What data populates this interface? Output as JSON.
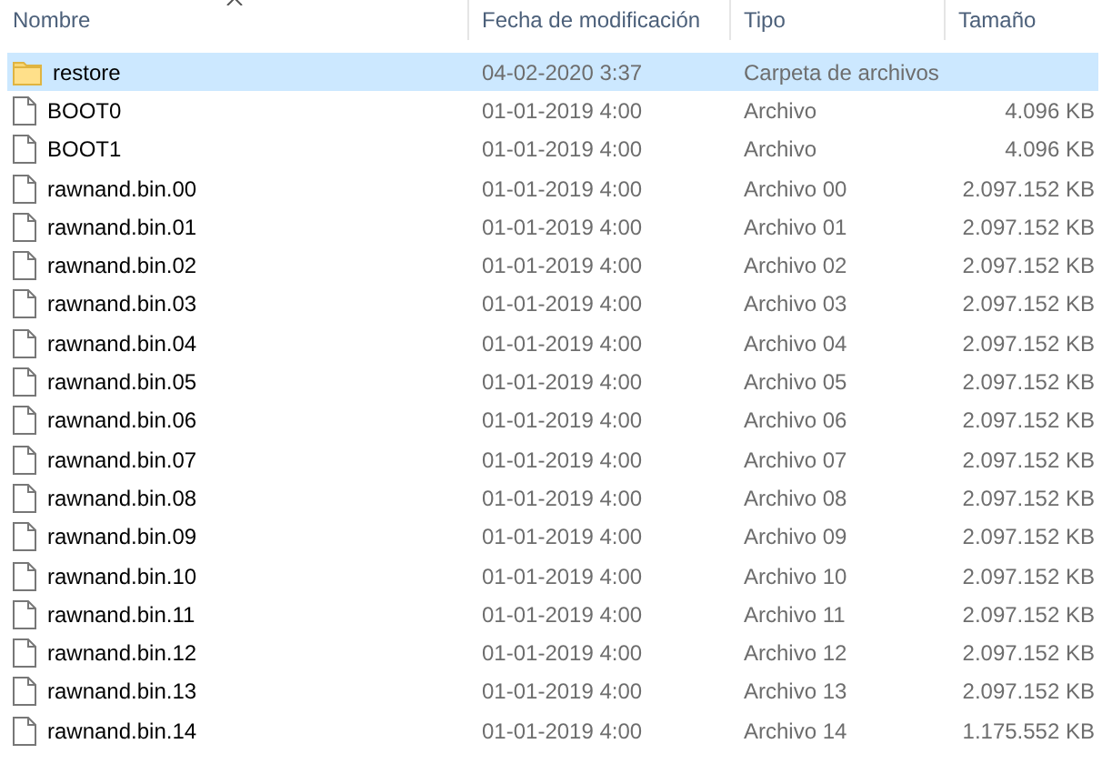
{
  "columns": [
    {
      "label": "Nombre",
      "sorted": true
    },
    {
      "label": "Fecha de modificación",
      "sorted": false
    },
    {
      "label": "Tipo",
      "sorted": false
    },
    {
      "label": "Tamaño",
      "sorted": false
    }
  ],
  "rows": [
    {
      "kind": "folder",
      "name": "restore",
      "date": "04-02-2020 3:37",
      "type": "Carpeta de archivos",
      "selected": true
    },
    {
      "kind": "file",
      "name": "BOOT0",
      "date": "01-01-2019 4:00",
      "type": "Archivo",
      "size": "4.096 KB",
      "selected": false
    },
    {
      "kind": "file",
      "name": "BOOT1",
      "date": "01-01-2019 4:00",
      "type": "Archivo",
      "size": "4.096 KB",
      "selected": false
    },
    {
      "kind": "file",
      "name": "rawnand.bin.00",
      "date": "01-01-2019 4:00",
      "type": "Archivo 00",
      "size": "2.097.152 KB",
      "selected": false
    },
    {
      "kind": "file",
      "name": "rawnand.bin.01",
      "date": "01-01-2019 4:00",
      "type": "Archivo 01",
      "size": "2.097.152 KB",
      "selected": false
    },
    {
      "kind": "file",
      "name": "rawnand.bin.02",
      "date": "01-01-2019 4:00",
      "type": "Archivo 02",
      "size": "2.097.152 KB",
      "selected": false
    },
    {
      "kind": "file",
      "name": "rawnand.bin.03",
      "date": "01-01-2019 4:00",
      "type": "Archivo 03",
      "size": "2.097.152 KB",
      "selected": false
    },
    {
      "kind": "file",
      "name": "rawnand.bin.04",
      "date": "01-01-2019 4:00",
      "type": "Archivo 04",
      "size": "2.097.152 KB",
      "selected": false
    },
    {
      "kind": "file",
      "name": "rawnand.bin.05",
      "date": "01-01-2019 4:00",
      "type": "Archivo 05",
      "size": "2.097.152 KB",
      "selected": false
    },
    {
      "kind": "file",
      "name": "rawnand.bin.06",
      "date": "01-01-2019 4:00",
      "type": "Archivo 06",
      "size": "2.097.152 KB",
      "selected": false
    },
    {
      "kind": "file",
      "name": "rawnand.bin.07",
      "date": "01-01-2019 4:00",
      "type": "Archivo 07",
      "size": "2.097.152 KB",
      "selected": false
    },
    {
      "kind": "file",
      "name": "rawnand.bin.08",
      "date": "01-01-2019 4:00",
      "type": "Archivo 08",
      "size": "2.097.152 KB",
      "selected": false
    },
    {
      "kind": "file",
      "name": "rawnand.bin.09",
      "date": "01-01-2019 4:00",
      "type": "Archivo 09",
      "size": "2.097.152 KB",
      "selected": false
    },
    {
      "kind": "file",
      "name": "rawnand.bin.10",
      "date": "01-01-2019 4:00",
      "type": "Archivo 10",
      "size": "2.097.152 KB",
      "selected": false
    },
    {
      "kind": "file",
      "name": "rawnand.bin.11",
      "date": "01-01-2019 4:00",
      "type": "Archivo 11",
      "size": "2.097.152 KB",
      "selected": false
    },
    {
      "kind": "file",
      "name": "rawnand.bin.12",
      "date": "01-01-2019 4:00",
      "type": "Archivo 12",
      "size": "2.097.152 KB",
      "selected": false
    },
    {
      "kind": "file",
      "name": "rawnand.bin.13",
      "date": "01-01-2019 4:00",
      "type": "Archivo 13",
      "size": "2.097.152 KB",
      "selected": false
    },
    {
      "kind": "file",
      "name": "rawnand.bin.14",
      "date": "01-01-2019 4:00",
      "type": "Archivo 14",
      "size": "1.175.552 KB",
      "selected": false
    }
  ]
}
